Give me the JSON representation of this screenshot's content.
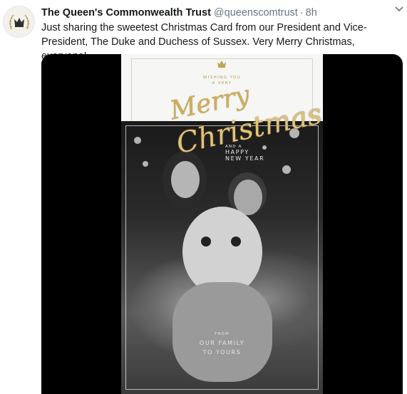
{
  "tweet": {
    "author_name": "The Queen's Commonwealth Trust",
    "handle": "@queenscomtrust",
    "separator": "·",
    "time": "8h",
    "text": "Just sharing the sweetest Christmas Card from our President and Vice-President, The Duke and Duchess of Sussex. Very Merry Christmas, everyone!"
  },
  "card": {
    "greeting_line1": "WISHING YOU",
    "greeting_line2": "A VERY",
    "merry": "Merry",
    "christmas": "Christmas",
    "and_a": "AND A",
    "happy": "HAPPY",
    "new_year": "NEW YEAR",
    "from": "FROM",
    "our_family": "OUR FAMILY",
    "to_yours": "TO YOURS"
  },
  "icons": {
    "avatar": "crown-emblem-icon",
    "caret": "chevron-down-icon"
  },
  "colors": {
    "text": "#14171a",
    "secondary": "#657786",
    "gold": "#cdae5c"
  }
}
